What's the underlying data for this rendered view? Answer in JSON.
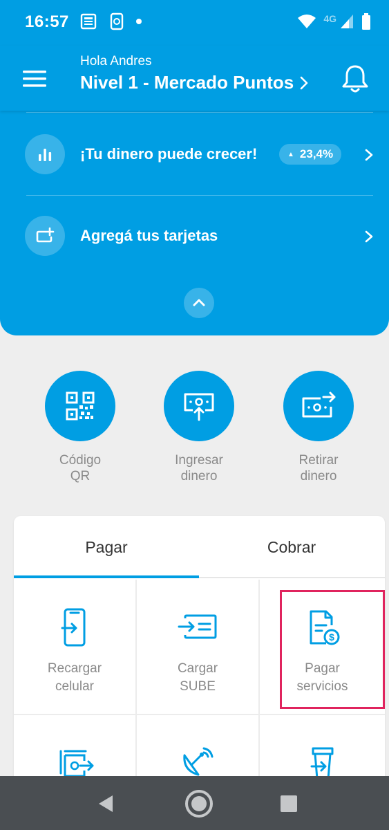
{
  "status_bar": {
    "time": "16:57",
    "network": "4G",
    "icons_left": [
      "news-icon",
      "phone-sync-icon",
      "dot-icon"
    ],
    "icons_right": [
      "wifi-icon",
      "signal-icon",
      "battery-icon"
    ]
  },
  "header": {
    "greeting": "Hola Andres",
    "level": "Nivel 1 - Mercado Puntos",
    "menu_icon": "hamburger-icon",
    "bell_icon": "bell-icon"
  },
  "panel": {
    "invest_label": "¡Tu dinero puede crecer!",
    "invest_badge": "23,4%",
    "cards_label": "Agregá tus tarjetas"
  },
  "actions": [
    {
      "line1": "Código",
      "line2": "QR",
      "icon": "qr-icon"
    },
    {
      "line1": "Ingresar",
      "line2": "dinero",
      "icon": "deposit-icon"
    },
    {
      "line1": "Retirar",
      "line2": "dinero",
      "icon": "withdraw-icon"
    }
  ],
  "tabs": {
    "pay": "Pagar",
    "charge": "Cobrar",
    "active": "pay"
  },
  "services": [
    {
      "line1": "Recargar",
      "line2": "celular",
      "icon": "phone-recharge-icon"
    },
    {
      "line1": "Cargar",
      "line2": "SUBE",
      "icon": "sube-card-icon"
    },
    {
      "line1": "Pagar",
      "line2": "servicios",
      "icon": "bill-icon"
    }
  ],
  "services_row2_icons": [
    "money-transfer-icon",
    "satellite-dish-icon",
    "cup-icon"
  ],
  "colors": {
    "brand": "#009ee3",
    "highlight": "#e0245e",
    "nav": "#4a4e52"
  }
}
